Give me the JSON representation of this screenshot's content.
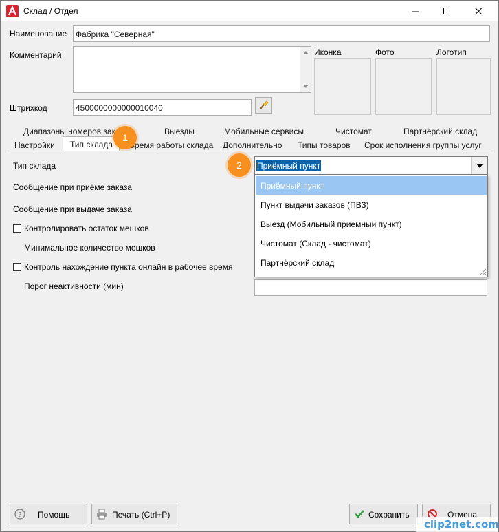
{
  "window": {
    "title": "Склад / Отдел",
    "minimize_icon": "minimize-icon",
    "maximize_icon": "maximize-icon",
    "close_icon": "close-icon"
  },
  "form": {
    "name_label": "Наименование",
    "name_value": "Фабрика \"Северная\"",
    "comment_label": "Комментарий",
    "comment_value": "",
    "barcode_label": "Штрихкод",
    "barcode_value": "4500000000000010040",
    "icon_label": "Иконка",
    "photo_label": "Фото",
    "logo_label": "Логотип"
  },
  "tabs_row1": [
    "Диапазоны номеров заказ",
    "Выезды",
    "Мобильные сервисы",
    "Чистомат",
    "Партнёрский склад"
  ],
  "tabs_row2": [
    "Настройки",
    "Тип склада",
    "Время работы склада",
    "Дополнительно",
    "Типы товаров",
    "Срок исполнения группы услуг"
  ],
  "badges": [
    "1",
    "2"
  ],
  "content": {
    "warehouse_type_label": "Тип склада",
    "warehouse_type_value": "Приёмный пункт",
    "msg_receive_label": "Сообщение при приёме заказа",
    "msg_issue_label": "Сообщение при выдаче заказа",
    "control_bags_label": "Контролировать остаток мешков",
    "min_bags_label": "Минимальное количество мешков",
    "online_control_label": "Контроль нахождение пункта онлайн в рабочее время",
    "inactivity_label": "Порог неактивности (мин)"
  },
  "dropdown_options": [
    "Приёмный пункт",
    "Пункт выдачи заказов (ПВЗ)",
    "Выезд (Мобильный приемный пункт)",
    "Чистомат (Склад - чистомат)",
    "Партнёрский склад"
  ],
  "buttons": {
    "help": "Помощь",
    "print": "Печать (Ctrl+P)",
    "save": "Сохранить",
    "cancel": "Отмена"
  },
  "watermark": "clip2net.com",
  "colors": {
    "accent_badge": "#f7901e",
    "selection": "#99c6f2",
    "combo_highlight": "#0a64ad",
    "app_red": "#d9232e",
    "save_green": "#2e9e3e",
    "cancel_red": "#cc2b2b"
  }
}
